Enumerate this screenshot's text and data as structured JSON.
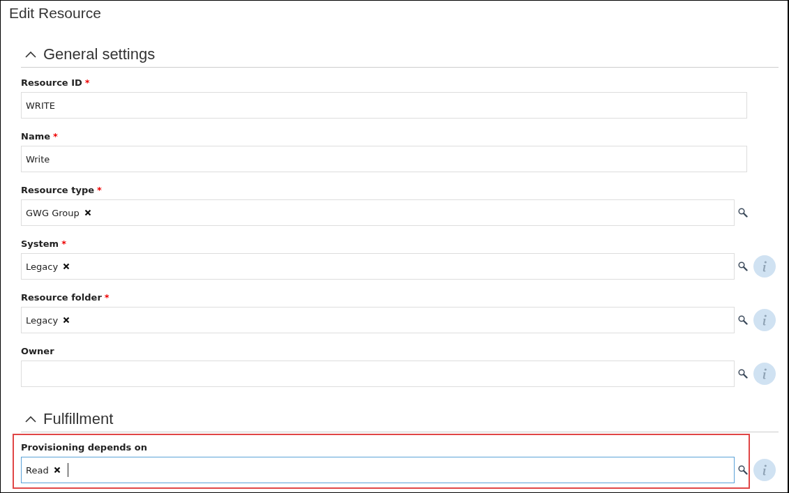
{
  "window": {
    "title": "Edit Resource"
  },
  "sections": [
    {
      "title": "General settings",
      "expanded": true,
      "fields": [
        {
          "label": "Resource ID",
          "required_mark": "*",
          "kind": "text",
          "value": "WRITE"
        },
        {
          "label": "Name",
          "required_mark": "*",
          "kind": "text",
          "value": "Write"
        },
        {
          "label": "Resource type",
          "required_mark": "*",
          "kind": "lookup",
          "tags": [
            "GWG Group"
          ],
          "info": false,
          "focused": false
        },
        {
          "label": "System",
          "required_mark": "*",
          "kind": "lookup",
          "tags": [
            "Legacy"
          ],
          "info": true,
          "focused": false
        },
        {
          "label": "Resource folder",
          "required_mark": "*",
          "kind": "lookup",
          "tags": [
            "Legacy"
          ],
          "info": true,
          "focused": false
        },
        {
          "label": "Owner",
          "kind": "lookup",
          "info": true,
          "focused": false
        }
      ]
    },
    {
      "title": "Fulfillment",
      "expanded": true,
      "fields": [
        {
          "label": "Provisioning depends on",
          "kind": "lookup",
          "tags": [
            "Read"
          ],
          "info": true,
          "focused": true,
          "highlighted": true
        }
      ]
    }
  ]
}
